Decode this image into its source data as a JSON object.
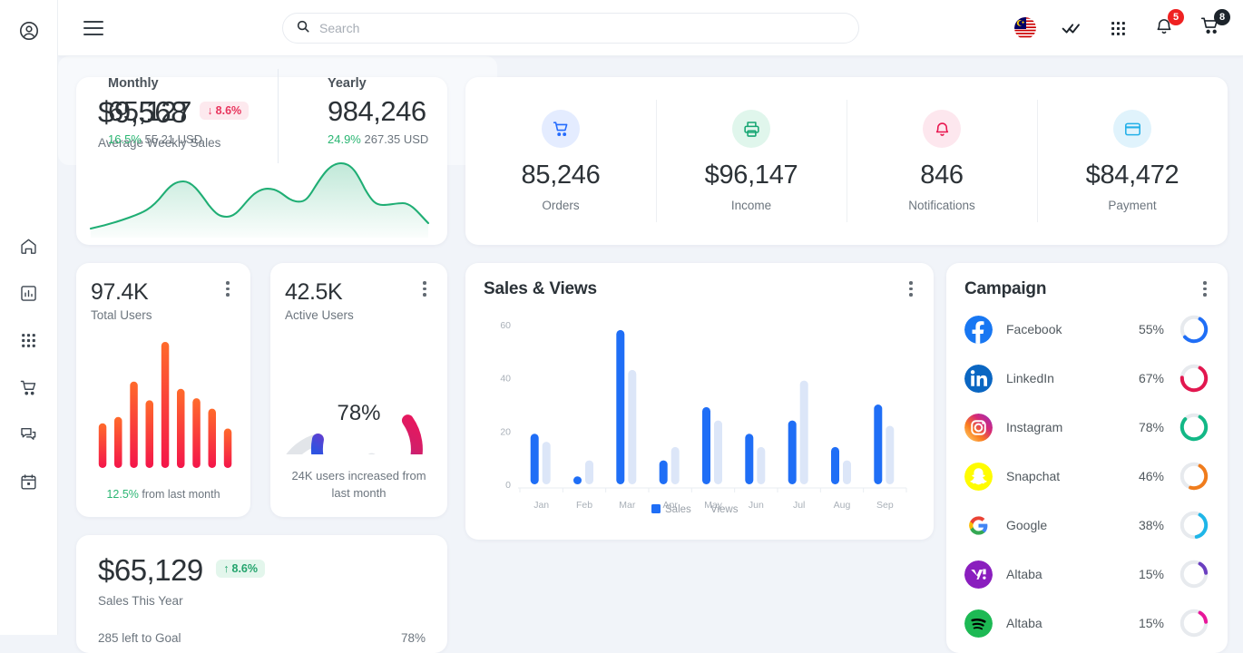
{
  "sidebar": {
    "profile_icon": "account-circle-icon",
    "items": [
      {
        "icon": "home-icon",
        "label": "Home"
      },
      {
        "icon": "chart-icon",
        "label": "Analytics"
      },
      {
        "icon": "apps-grid-icon",
        "label": "Apps"
      },
      {
        "icon": "cart-icon",
        "label": "Shop"
      },
      {
        "icon": "chat-icon",
        "label": "Messages"
      },
      {
        "icon": "calendar-icon",
        "label": "Calendar"
      }
    ]
  },
  "topbar": {
    "menu_icon": "hamburger-menu-icon",
    "search": {
      "placeholder": "Search",
      "value": "",
      "icon": "search-icon"
    },
    "flag": {
      "name": "malaysia-flag-icon",
      "label": "Malaysia"
    },
    "check_icon": "double-check-icon",
    "apps_icon": "apps-grid-icon",
    "notifications": {
      "icon": "bell-icon",
      "badge": "5",
      "badge_color": "#ef2121"
    },
    "cart": {
      "icon": "cart-icon",
      "badge": "8",
      "badge_color": "#1d242b"
    }
  },
  "weekly_sales": {
    "value": "$9,568",
    "delta": "8.6%",
    "delta_dir": "down",
    "delta_arrow": "↓",
    "label": "Average Weekly Sales",
    "line_color": "#1fae74"
  },
  "stats": [
    {
      "icon": "cart-icon",
      "value": "85,246",
      "caption": "Orders",
      "color": "#246bfd",
      "bg": "#e4ecff"
    },
    {
      "icon": "printer-icon",
      "value": "$96,147",
      "caption": "Income",
      "color": "#17a673",
      "bg": "#e0f6ec"
    },
    {
      "icon": "bell-icon",
      "value": "846",
      "caption": "Notifications",
      "color": "#e8164f",
      "bg": "#fde7ee"
    },
    {
      "icon": "card-icon",
      "value": "$84,472",
      "caption": "Payment",
      "color": "#23b0e8",
      "bg": "#e0f3fc"
    }
  ],
  "total_users": {
    "value": "97.4K",
    "label": "Total Users",
    "footer_pct": "12.5%",
    "footer_text": "from last month",
    "bars": [
      22,
      28,
      62,
      44,
      100,
      55,
      46,
      36,
      17
    ],
    "grad_top": "#ff6a2b",
    "grad_bottom": "#f4164a"
  },
  "active_users": {
    "value": "42.5K",
    "label": "Active Users",
    "percent_text": "78%",
    "percent": 78,
    "footer_text": "24K users increased from last month",
    "grad_start": "#1f5ff0",
    "grad_mid": "#8b2ec2",
    "grad_end": "#e8175d",
    "track": "#e2e5e9"
  },
  "sales_views": {
    "title": "Sales & Views",
    "legend": [
      {
        "label": "Sales",
        "color": "#1f6ef6"
      },
      {
        "label": "Views",
        "color": "#dce6f8"
      }
    ]
  },
  "chart_data": {
    "type": "bar",
    "title": "Sales & Views",
    "categories": [
      "Jan",
      "Feb",
      "Mar",
      "Apr",
      "May",
      "Jun",
      "Jul",
      "Aug",
      "Sep"
    ],
    "series": [
      {
        "name": "Sales",
        "color": "#1f6ef6",
        "values": [
          19,
          3,
          58,
          9,
          29,
          19,
          24,
          14,
          30
        ]
      },
      {
        "name": "Views",
        "color": "#dce6f8",
        "values": [
          16,
          9,
          43,
          14,
          24,
          14,
          39,
          9,
          22
        ]
      }
    ],
    "xlabel": "",
    "ylabel": "",
    "ylim": [
      0,
      60
    ],
    "yticks": [
      0,
      20,
      40,
      60
    ],
    "grid": false,
    "legend_position": "bottom"
  },
  "monthly_yearly": [
    {
      "head": "Monthly",
      "value": "65,127",
      "pct": "16.5%",
      "usd": "55.21 USD"
    },
    {
      "head": "Yearly",
      "value": "984,246",
      "pct": "24.9%",
      "usd": "267.35 USD"
    }
  ],
  "sales_year": {
    "value": "$65,129",
    "delta": "8.6%",
    "delta_arrow": "↑",
    "label": "Sales This Year",
    "goal_text": "285 left to Goal",
    "goal_pct": "78%"
  },
  "campaign": {
    "title": "Campaign",
    "rows": [
      {
        "name": "Facebook",
        "pct": "55%",
        "value": 55,
        "ring": "#1f6ef6",
        "logo": "facebook-logo-icon"
      },
      {
        "name": "LinkedIn",
        "pct": "67%",
        "value": 67,
        "ring": "#e2174f",
        "logo": "linkedin-logo-icon"
      },
      {
        "name": "Instagram",
        "pct": "78%",
        "value": 78,
        "ring": "#12b886",
        "logo": "instagram-logo-icon"
      },
      {
        "name": "Snapchat",
        "pct": "46%",
        "value": 46,
        "ring": "#f07c1c",
        "logo": "snapchat-logo-icon"
      },
      {
        "name": "Google",
        "pct": "38%",
        "value": 38,
        "ring": "#1fb6e8",
        "logo": "google-logo-icon"
      },
      {
        "name": "Altaba",
        "pct": "15%",
        "value": 15,
        "ring": "#6b3fc0",
        "logo": "yahoo-logo-icon"
      },
      {
        "name": "Altaba",
        "pct": "15%",
        "value": 15,
        "ring": "#e8179a",
        "logo": "spotify-logo-icon"
      }
    ]
  }
}
